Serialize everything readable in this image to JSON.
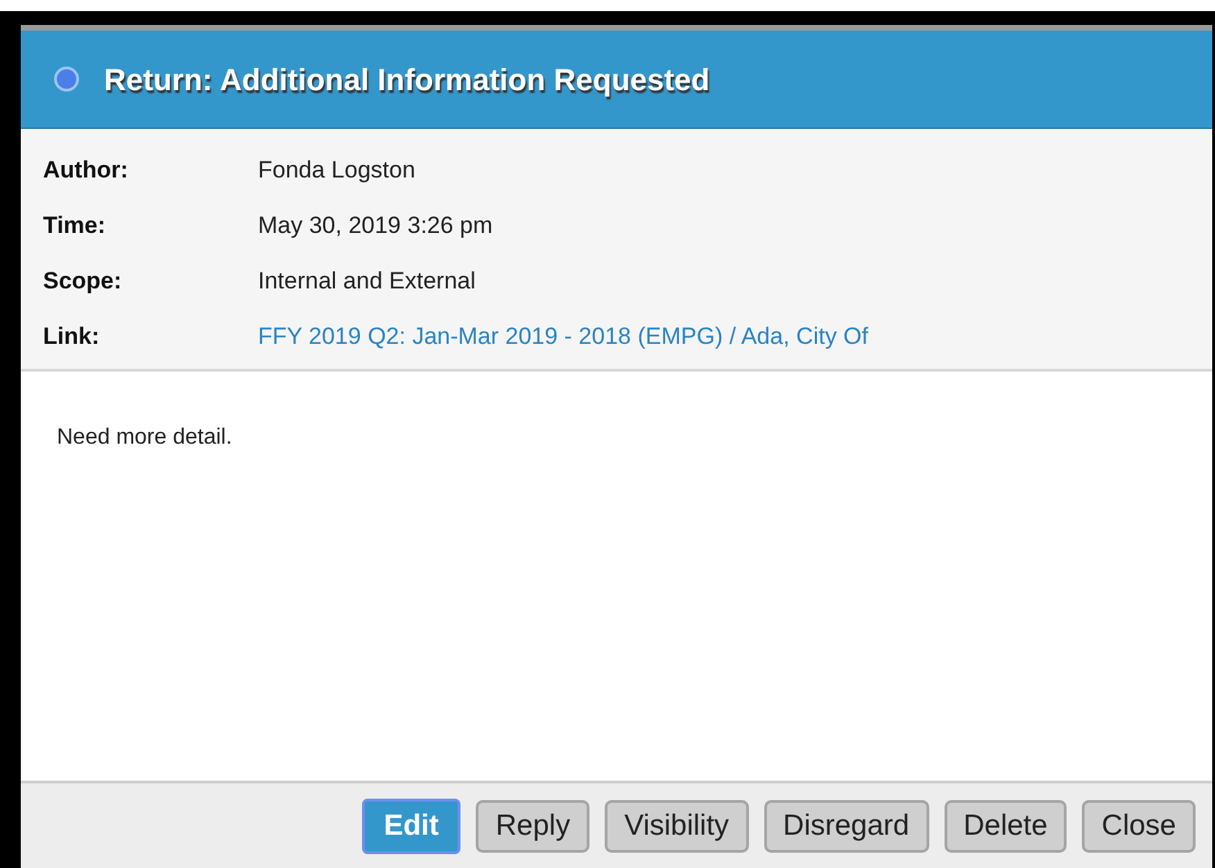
{
  "dialog": {
    "title": "Return: Additional Information Requested"
  },
  "details": [
    {
      "label": "Author:",
      "value": "Fonda Logston",
      "kind": "text"
    },
    {
      "label": "Time:",
      "value": "May 30, 2019 3:26 pm",
      "kind": "text"
    },
    {
      "label": "Scope:",
      "value": "Internal and External",
      "kind": "text"
    },
    {
      "label": "Link:",
      "value": "FFY 2019 Q2: Jan-Mar 2019 - 2018 (EMPG) / Ada, City Of",
      "kind": "link"
    }
  ],
  "message": "Need more detail.",
  "buttons": [
    {
      "label": "Edit",
      "focused": true
    },
    {
      "label": "Reply",
      "focused": false
    },
    {
      "label": "Visibility",
      "focused": false
    },
    {
      "label": "Disregard",
      "focused": false
    },
    {
      "label": "Delete",
      "focused": false
    },
    {
      "label": "Close",
      "focused": false
    }
  ]
}
